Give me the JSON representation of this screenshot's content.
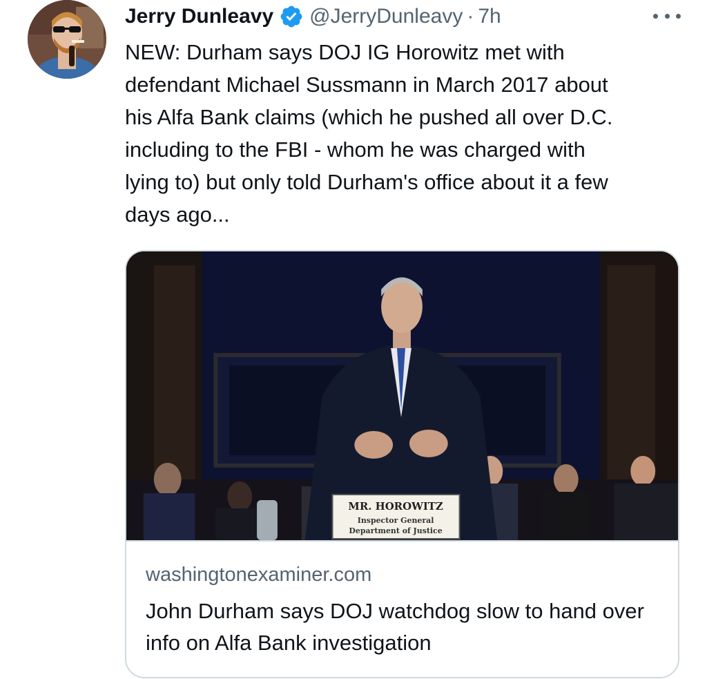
{
  "tweet": {
    "author_name": "Jerry Dunleavy",
    "handle": "@JerryDunleavy",
    "separator": "·",
    "time": "7h",
    "text": "NEW: Durham says DOJ IG Horowitz met with\ndefendant Michael Sussmann in March 2017 about\nhis Alfa Bank claims (which he pushed all over D.C.\nincluding to the FBI - whom he was charged with\nlying to) but only told Durham's office about it a few\ndays ago...",
    "icons": {
      "verified": "verified-badge-icon",
      "more": "more-options-icon"
    },
    "colors": {
      "verified_blue": "#1d9bf0",
      "secondary_text": "#536471",
      "border": "#cfd9de"
    }
  },
  "card": {
    "domain": "washingtonexaminer.com",
    "title": "John Durham says DOJ watchdog slow to hand over info on Alfa Bank investigation",
    "image": {
      "nameplate_line1": "MR. HOROWITZ",
      "nameplate_line2": "Inspector General",
      "nameplate_line3": "Department of Justice"
    }
  }
}
